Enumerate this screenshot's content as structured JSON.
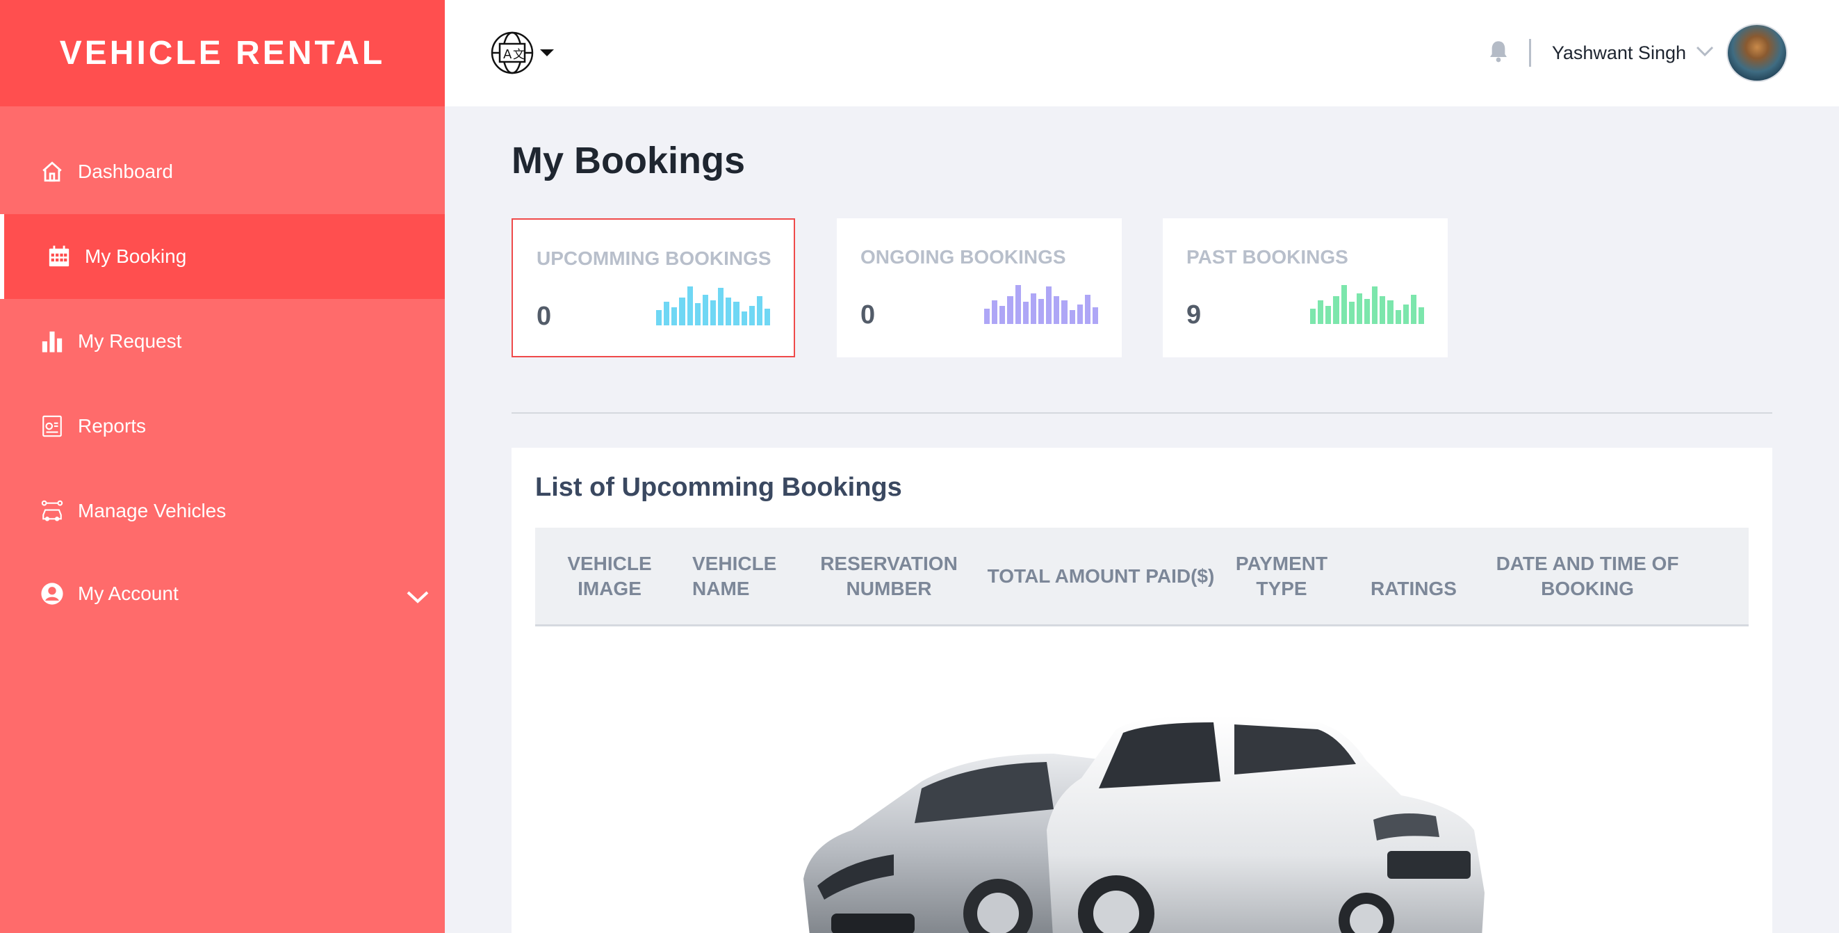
{
  "brand": "VEHICLE RENTAL",
  "sidebar": {
    "items": [
      {
        "label": "Dashboard",
        "icon": "home-icon"
      },
      {
        "label": "My Booking",
        "icon": "calendar-icon",
        "active": true
      },
      {
        "label": "My Request",
        "icon": "bar-chart-icon"
      },
      {
        "label": "Reports",
        "icon": "report-icon"
      },
      {
        "label": "Manage Vehicles",
        "icon": "car-network-icon"
      },
      {
        "label": "My Account",
        "icon": "user-circle-icon",
        "expandable": true
      }
    ]
  },
  "header": {
    "language_icon": "translate-globe-icon",
    "user_name": "Yashwant Singh"
  },
  "page": {
    "title": "My Bookings"
  },
  "stats": [
    {
      "label": "UPCOMMING BOOKINGS",
      "value": "0",
      "color": "#5fd3f3",
      "selected": true
    },
    {
      "label": "ONGOING BOOKINGS",
      "value": "0",
      "color": "#a59cf5"
    },
    {
      "label": "PAST BOOKINGS",
      "value": "9",
      "color": "#6ee3a3"
    }
  ],
  "bookings": {
    "title": "List of Upcomming Bookings",
    "columns": [
      "VEHICLE IMAGE",
      "VEHICLE NAME",
      "RESERVATION NUMBER",
      "TOTAL AMOUNT PAID($)",
      "PAYMENT TYPE",
      "RATINGS",
      "DATE AND TIME OF BOOKING"
    ],
    "empty_state_image": "two-cars-illustration"
  },
  "colors": {
    "sidebar": "#ff6b6b",
    "sidebar_active": "#ff4f4f",
    "selected_border": "#ef4a4a"
  }
}
